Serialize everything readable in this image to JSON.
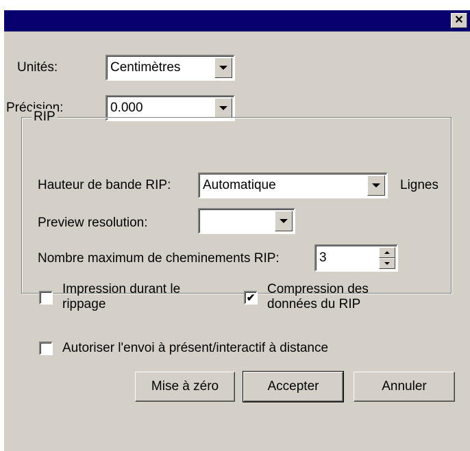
{
  "titlebar": {
    "close_glyph": "✕"
  },
  "units": {
    "label": "Unités:",
    "value": "Centimètres"
  },
  "precision": {
    "label": "Précision:",
    "value": "0.000"
  },
  "rip": {
    "group_title": "RIP",
    "band_height": {
      "label": "Hauteur de bande RIP:",
      "value": "Automatique",
      "unit": "Lignes"
    },
    "preview_resolution": {
      "label": "Preview resolution:",
      "value": ""
    },
    "max_paths": {
      "label": "Nombre maximum de cheminements RIP:",
      "value": "3"
    },
    "print_during_rip": {
      "label_line1": "Impression durant le",
      "label_line2": "rippage",
      "checked": false
    },
    "compress_rip_data": {
      "label_line1": "Compression des",
      "label_line2": "données du RIP",
      "checked": true,
      "check_glyph": "✔"
    }
  },
  "allow_remote": {
    "label": "Autoriser l'envoi à présent/interactif à distance",
    "checked": false
  },
  "buttons": {
    "reset": "Mise à zéro",
    "accept": "Accepter",
    "cancel": "Annuler"
  },
  "colors": {
    "titlebar": "#08006e",
    "face": "#d4d0c8"
  }
}
